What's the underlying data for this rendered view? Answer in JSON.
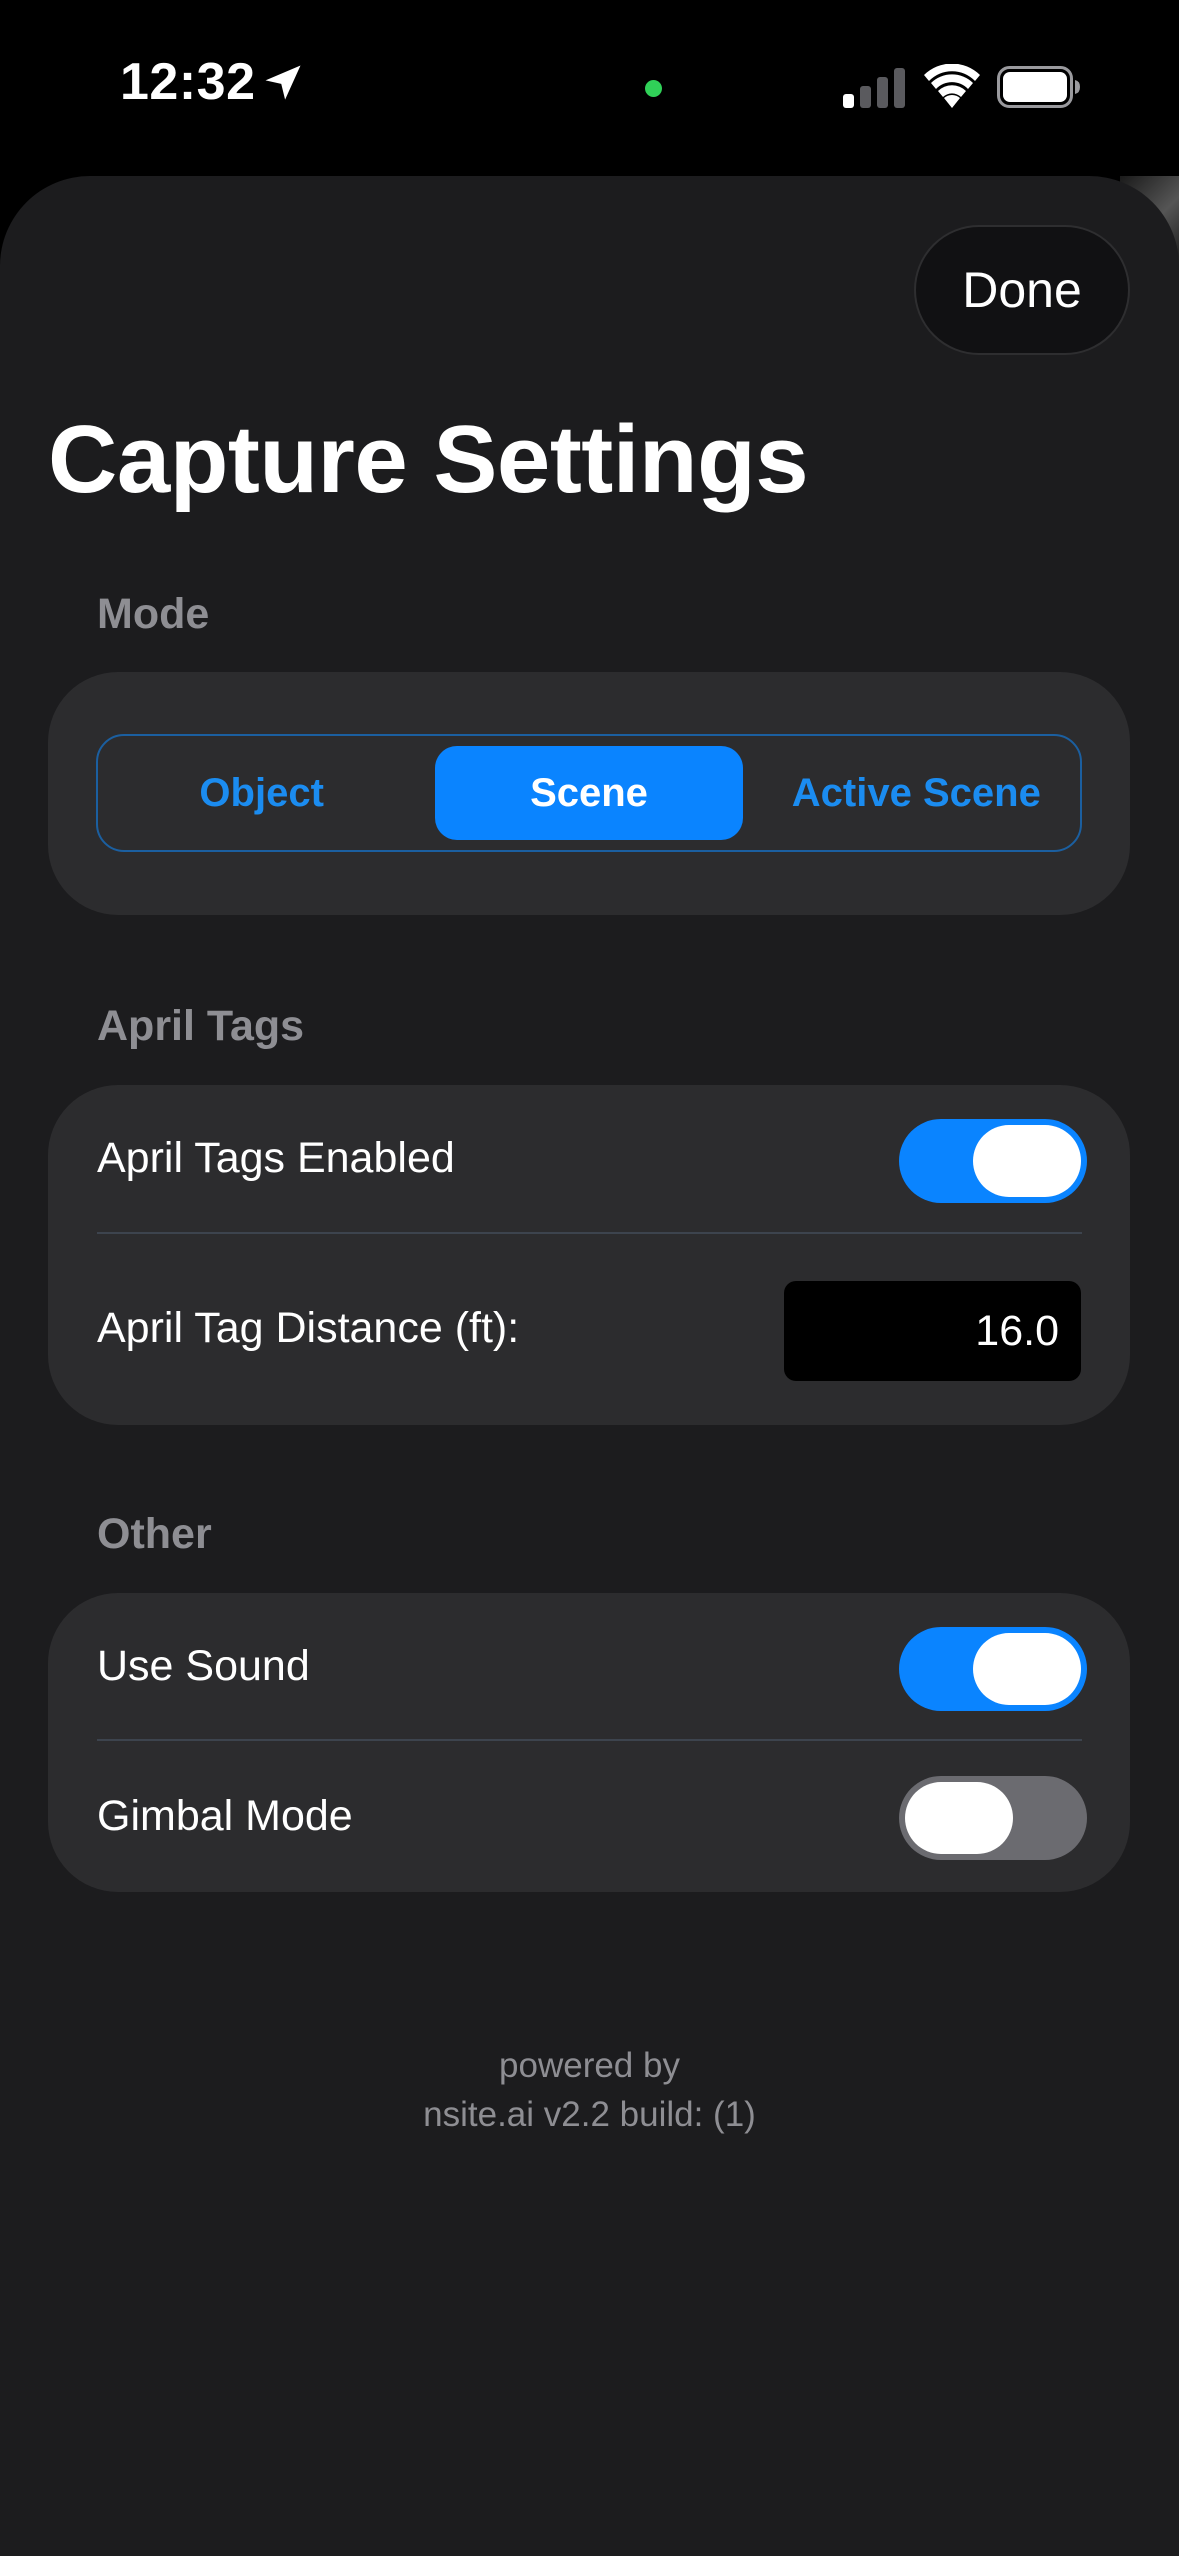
{
  "status_bar": {
    "time": "12:32"
  },
  "header": {
    "done_label": "Done",
    "title": "Capture Settings"
  },
  "mode_section": {
    "header": "Mode",
    "segments": [
      "Object",
      "Scene",
      "Active Scene"
    ],
    "selected": "Scene"
  },
  "april_tags_section": {
    "header": "April Tags",
    "enabled_label": "April Tags Enabled",
    "enabled": true,
    "distance_label": "April Tag Distance (ft):",
    "distance_value": "16.0"
  },
  "other_section": {
    "header": "Other",
    "use_sound_label": "Use Sound",
    "use_sound": true,
    "gimbal_mode_label": "Gimbal Mode",
    "gimbal_mode": false
  },
  "footer": {
    "line1": "powered by",
    "line2": "nsite.ai v2.2 build: (1)"
  },
  "colors": {
    "accent": "#0a84ff",
    "background": "#1c1c1e",
    "card": "#2c2c2e",
    "secondary_text": "#8e8e93",
    "status_dot": "#30d158"
  }
}
